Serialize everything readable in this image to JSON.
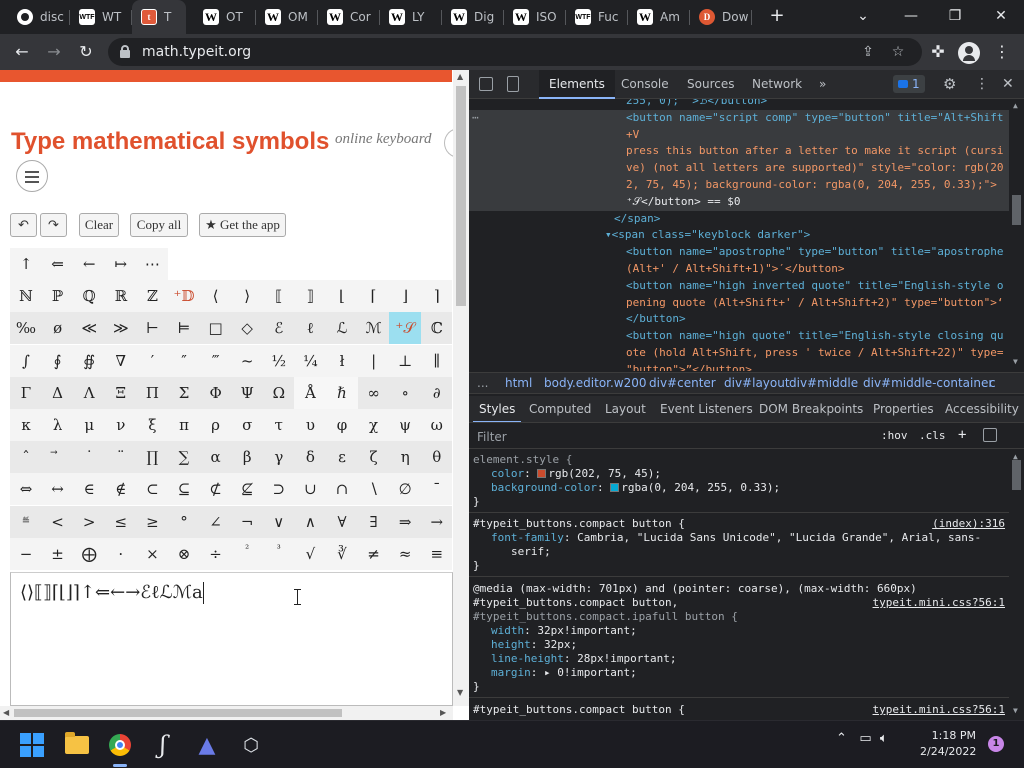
{
  "browser": {
    "tabs": [
      {
        "label": "disc",
        "icon": "discord-icon",
        "fav": "disc"
      },
      {
        "label": "WT",
        "icon": "wtf-icon",
        "fav": "wtf",
        "favtext": "WTF"
      },
      {
        "label": "T",
        "icon": "typeit-icon",
        "fav": "typeit",
        "favtext": "t",
        "active": true
      },
      {
        "label": "OT",
        "icon": "wikipedia-icon",
        "fav": "w",
        "favtext": "W"
      },
      {
        "label": "OM",
        "icon": "wikipedia-icon",
        "fav": "w",
        "favtext": "W"
      },
      {
        "label": "Cor",
        "icon": "wikipedia-icon",
        "fav": "w",
        "favtext": "W"
      },
      {
        "label": "LY",
        "icon": "wikipedia-icon",
        "fav": "w",
        "favtext": "W"
      },
      {
        "label": "Dig",
        "icon": "wikipedia-icon",
        "fav": "w",
        "favtext": "W"
      },
      {
        "label": "ISO",
        "icon": "wikipedia-icon",
        "fav": "w",
        "favtext": "W"
      },
      {
        "label": "Fuc",
        "icon": "wtf-icon",
        "fav": "wtf",
        "favtext": "WTF"
      },
      {
        "label": "Am",
        "icon": "wikipedia-icon",
        "fav": "w",
        "favtext": "W"
      },
      {
        "label": "Dow",
        "icon": "duckduckgo-icon",
        "fav": "ddg",
        "favtext": "D"
      }
    ],
    "new_tab": "+",
    "url": "math.typeit.org"
  },
  "page": {
    "title": "Type mathematical symbols",
    "tagline": "online keyboard",
    "buttons": {
      "undo": "↶",
      "redo": "↷",
      "clear": "Clear",
      "copy_all": "Copy all",
      "get_app": "★ Get the app"
    },
    "top_row": [
      "↑",
      "⇐",
      "←",
      "↦",
      "⋯"
    ],
    "keyboard_rows": [
      [
        "ℕ",
        "ℙ",
        "ℚ",
        "ℝ",
        "ℤ",
        "⁺𝔻",
        "⟨",
        "⟩",
        "⟦",
        "⟧",
        "⌊",
        "⌈",
        "⌋",
        "⌉"
      ],
      [
        "‰",
        "ø",
        "≪",
        "≫",
        "⊢",
        "⊨",
        "□",
        "◇",
        "ℰ",
        "ℓ",
        "ℒ",
        "ℳ",
        "⁺𝒮",
        "ℂ"
      ],
      [
        "∫",
        "∮",
        "∯",
        "∇",
        "′",
        "″",
        "‴",
        "~",
        "½",
        "¼",
        "ł",
        "|",
        "⊥",
        "∥"
      ],
      [
        "Γ",
        "Δ",
        "Λ",
        "Ξ",
        "Π",
        "Σ",
        "Φ",
        "Ψ",
        "Ω",
        "Å",
        "ℏ",
        "∞",
        "∘",
        "∂"
      ],
      [
        "κ",
        "λ",
        "μ",
        "ν",
        "ξ",
        "π",
        "ρ",
        "σ",
        "τ",
        "υ",
        "φ",
        "χ",
        "ψ",
        "ω"
      ],
      [
        "ˆ",
        "⃗",
        "˙",
        "¨",
        "∏",
        "∑",
        "α",
        "β",
        "γ",
        "δ",
        "ε",
        "ζ",
        "η",
        "θ"
      ],
      [
        "⇔",
        "↔",
        "∈",
        "∉",
        "⊂",
        "⊆",
        "⊄",
        "⊈",
        "⊃",
        "∪",
        "∩",
        "∖",
        "∅",
        "¯"
      ],
      [
        "≝",
        "<",
        ">",
        "≤",
        "≥",
        "°",
        "∠",
        "¬",
        "∨",
        "∧",
        "∀",
        "∃",
        "⇒",
        "→"
      ],
      [
        "−",
        "±",
        "⨁",
        "·",
        "×",
        "⊗",
        "÷",
        "²",
        "³",
        "√",
        "∛",
        "≠",
        "≈",
        "≡"
      ]
    ],
    "text_content": "⟨⟩⟦⟧⌈⌊⌋⌉↑⇐←→ℰℓℒℳa"
  },
  "devtools": {
    "tabs": [
      "Elements",
      "Console",
      "Sources",
      "Network",
      "»"
    ],
    "issues_count": "1",
    "elements_lines": [
      {
        "kind": "raw",
        "text": "255, 0); \">ℬ</button>"
      },
      {
        "kind": "sel",
        "text": "<button name=\"script comp\" type=\"button\" title=\"Alt+Shift"
      },
      {
        "kind": "sel",
        "text": "+V"
      },
      {
        "kind": "sel",
        "text": "press this button after a letter to make it script (cursi"
      },
      {
        "kind": "sel",
        "text": "ve) (not all letters are supported)\" style=\"color: rgb(20"
      },
      {
        "kind": "sel",
        "text": "2, 75, 45); background-color: rgba(0, 204, 255, 0.33);\">"
      },
      {
        "kind": "sel",
        "text": "⁺𝒮</button> == $0"
      },
      {
        "kind": "tag",
        "text": "</span>"
      },
      {
        "kind": "tag",
        "text": "▾<span class=\"keyblock darker\">"
      },
      {
        "kind": "tag",
        "text": "<button name=\"apostrophe\" type=\"button\" title=\"apostrophe"
      },
      {
        "kind": "tag",
        "text": "(Alt+' / Alt+Shift+1)\">′</button>"
      },
      {
        "kind": "tag",
        "text": "<button name=\"high inverted quote\" title=\"English-style o"
      },
      {
        "kind": "tag",
        "text": "pening quote (Alt+Shift+' / Alt+Shift+2)\" type=\"button\">‘"
      },
      {
        "kind": "tag",
        "text": "</button>"
      },
      {
        "kind": "tag",
        "text": "<button name=\"high quote\" title=\"English-style closing qu"
      },
      {
        "kind": "tag",
        "text": "ote (hold Alt+Shift, press ' twice / Alt+Shift+22)\" type="
      },
      {
        "kind": "tag",
        "text": "\"button\">”</button>"
      }
    ],
    "breadcrumbs": [
      "...",
      "html",
      "body.editor.w200",
      "div#center",
      "div#layout",
      "div#middle",
      "div#middle-container",
      "c"
    ],
    "style_tabs": [
      "Styles",
      "Computed",
      "Layout",
      "Event Listeners",
      "DOM Breakpoints",
      "Properties",
      "Accessibility"
    ],
    "filter_placeholder": "Filter",
    "hov": ":hov",
    "cls": ".cls",
    "plus": "+",
    "rules": {
      "element_style": "element.style {",
      "color_prop": "color",
      "color_val": "rgb(202, 75, 45);",
      "bg_prop": "background-color",
      "bg_val": "rgba(0, 204, 255, 0.33);",
      "close": "}",
      "rule2_sel": "#typeit_buttons.compact button {",
      "rule2_src": "(index):316",
      "rule2_prop": "font-family",
      "rule2_val1": "Cambria, \"Lucida Sans Unicode\", \"Lucida Grande\", Arial, sans-",
      "rule2_val2": "serif;",
      "media": "@media (max-width: 701px) and (pointer: coarse), (max-width: 660px)",
      "rule3_sel": "#typeit_buttons.compact button,",
      "rule3_src": "typeit.mini.css?56:1",
      "rule3_sel2": "#typeit_buttons.compact.ipafull button {",
      "rule3_p1": "width",
      "rule3_v1": "32px!important;",
      "rule3_p2": "height",
      "rule3_v2": "32px;",
      "rule3_p3": "line-height",
      "rule3_v3": "28px!important;",
      "rule3_p4": "margin",
      "rule3_v4": "▸ 0!important;",
      "rule4_sel": "#typeit_buttons.compact button {",
      "rule4_src": "typeit.mini.css?56:1"
    }
  },
  "taskbar": {
    "time": "1:18 PM",
    "date": "2/24/2022",
    "notifications": "1"
  },
  "colors": {
    "accent": "#e0512d",
    "highlight": "rgba(0,204,255,0.33)",
    "highlight_text": "#ca4b2d"
  }
}
